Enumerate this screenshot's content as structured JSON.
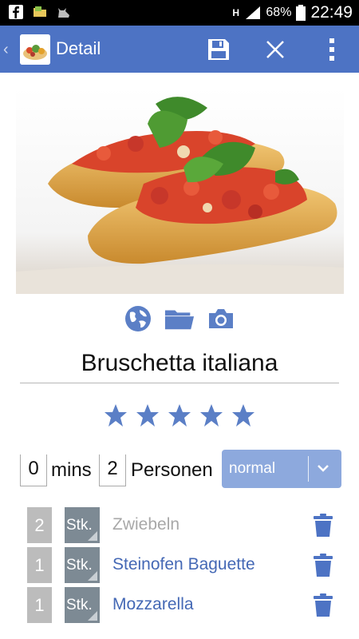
{
  "status_bar": {
    "network": "H",
    "battery": "68%",
    "time": "22:49"
  },
  "app_bar": {
    "title": "Detail"
  },
  "recipe": {
    "title": "Bruschetta italiana",
    "rating": 5,
    "rating_max": 5,
    "time_value": "0",
    "time_unit": "mins",
    "persons_value": "2",
    "persons_label": "Personen",
    "difficulty": "normal"
  },
  "ingredients": [
    {
      "qty": "2",
      "unit": "Stk.",
      "name": "Zwiebeln",
      "style": "grey"
    },
    {
      "qty": "1",
      "unit": "Stk.",
      "name": "Steinofen Baguette",
      "style": "blue"
    },
    {
      "qty": "1",
      "unit": "Stk.",
      "name": "Mozzarella",
      "style": "blue"
    }
  ],
  "colors": {
    "app_bar": "#4d73c4",
    "accent": "#4d73c4",
    "spinner": "#8da9dd"
  }
}
